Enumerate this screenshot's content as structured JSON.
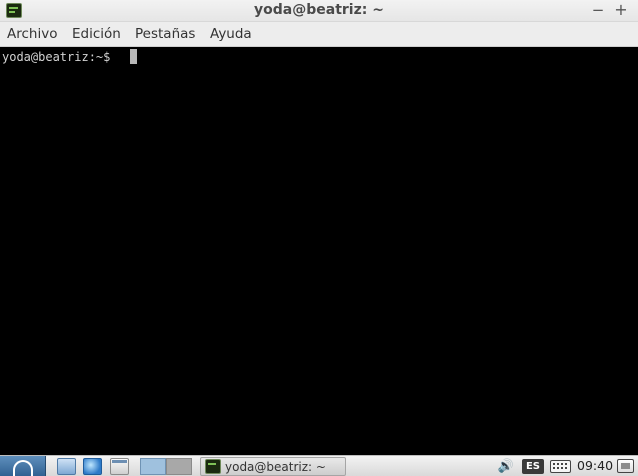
{
  "window": {
    "title": "yoda@beatriz: ~",
    "minimize_symbol": "−",
    "close_symbol": "+",
    "icon": "terminal-icon"
  },
  "menubar": {
    "items": [
      "Archivo",
      "Edición",
      "Pestañas",
      "Ayuda"
    ]
  },
  "terminal": {
    "prompt": "yoda@beatriz:~$ ",
    "background": "#000000",
    "foreground": "#d3d3d3"
  },
  "taskbar": {
    "start_icon": "start-menu-icon",
    "launchers": [
      "files-icon",
      "browser-icon",
      "window-icon"
    ],
    "workspaces": 2,
    "tasks": [
      {
        "label": "yoda@beatriz: ~",
        "icon": "terminal-icon"
      }
    ],
    "tray": {
      "volume_icon": "volume-icon",
      "keyboard_layout": "ES",
      "keyboard_icon": "keyboard-icon",
      "clock": "09:40",
      "screen_icon": "screen-icon"
    }
  }
}
